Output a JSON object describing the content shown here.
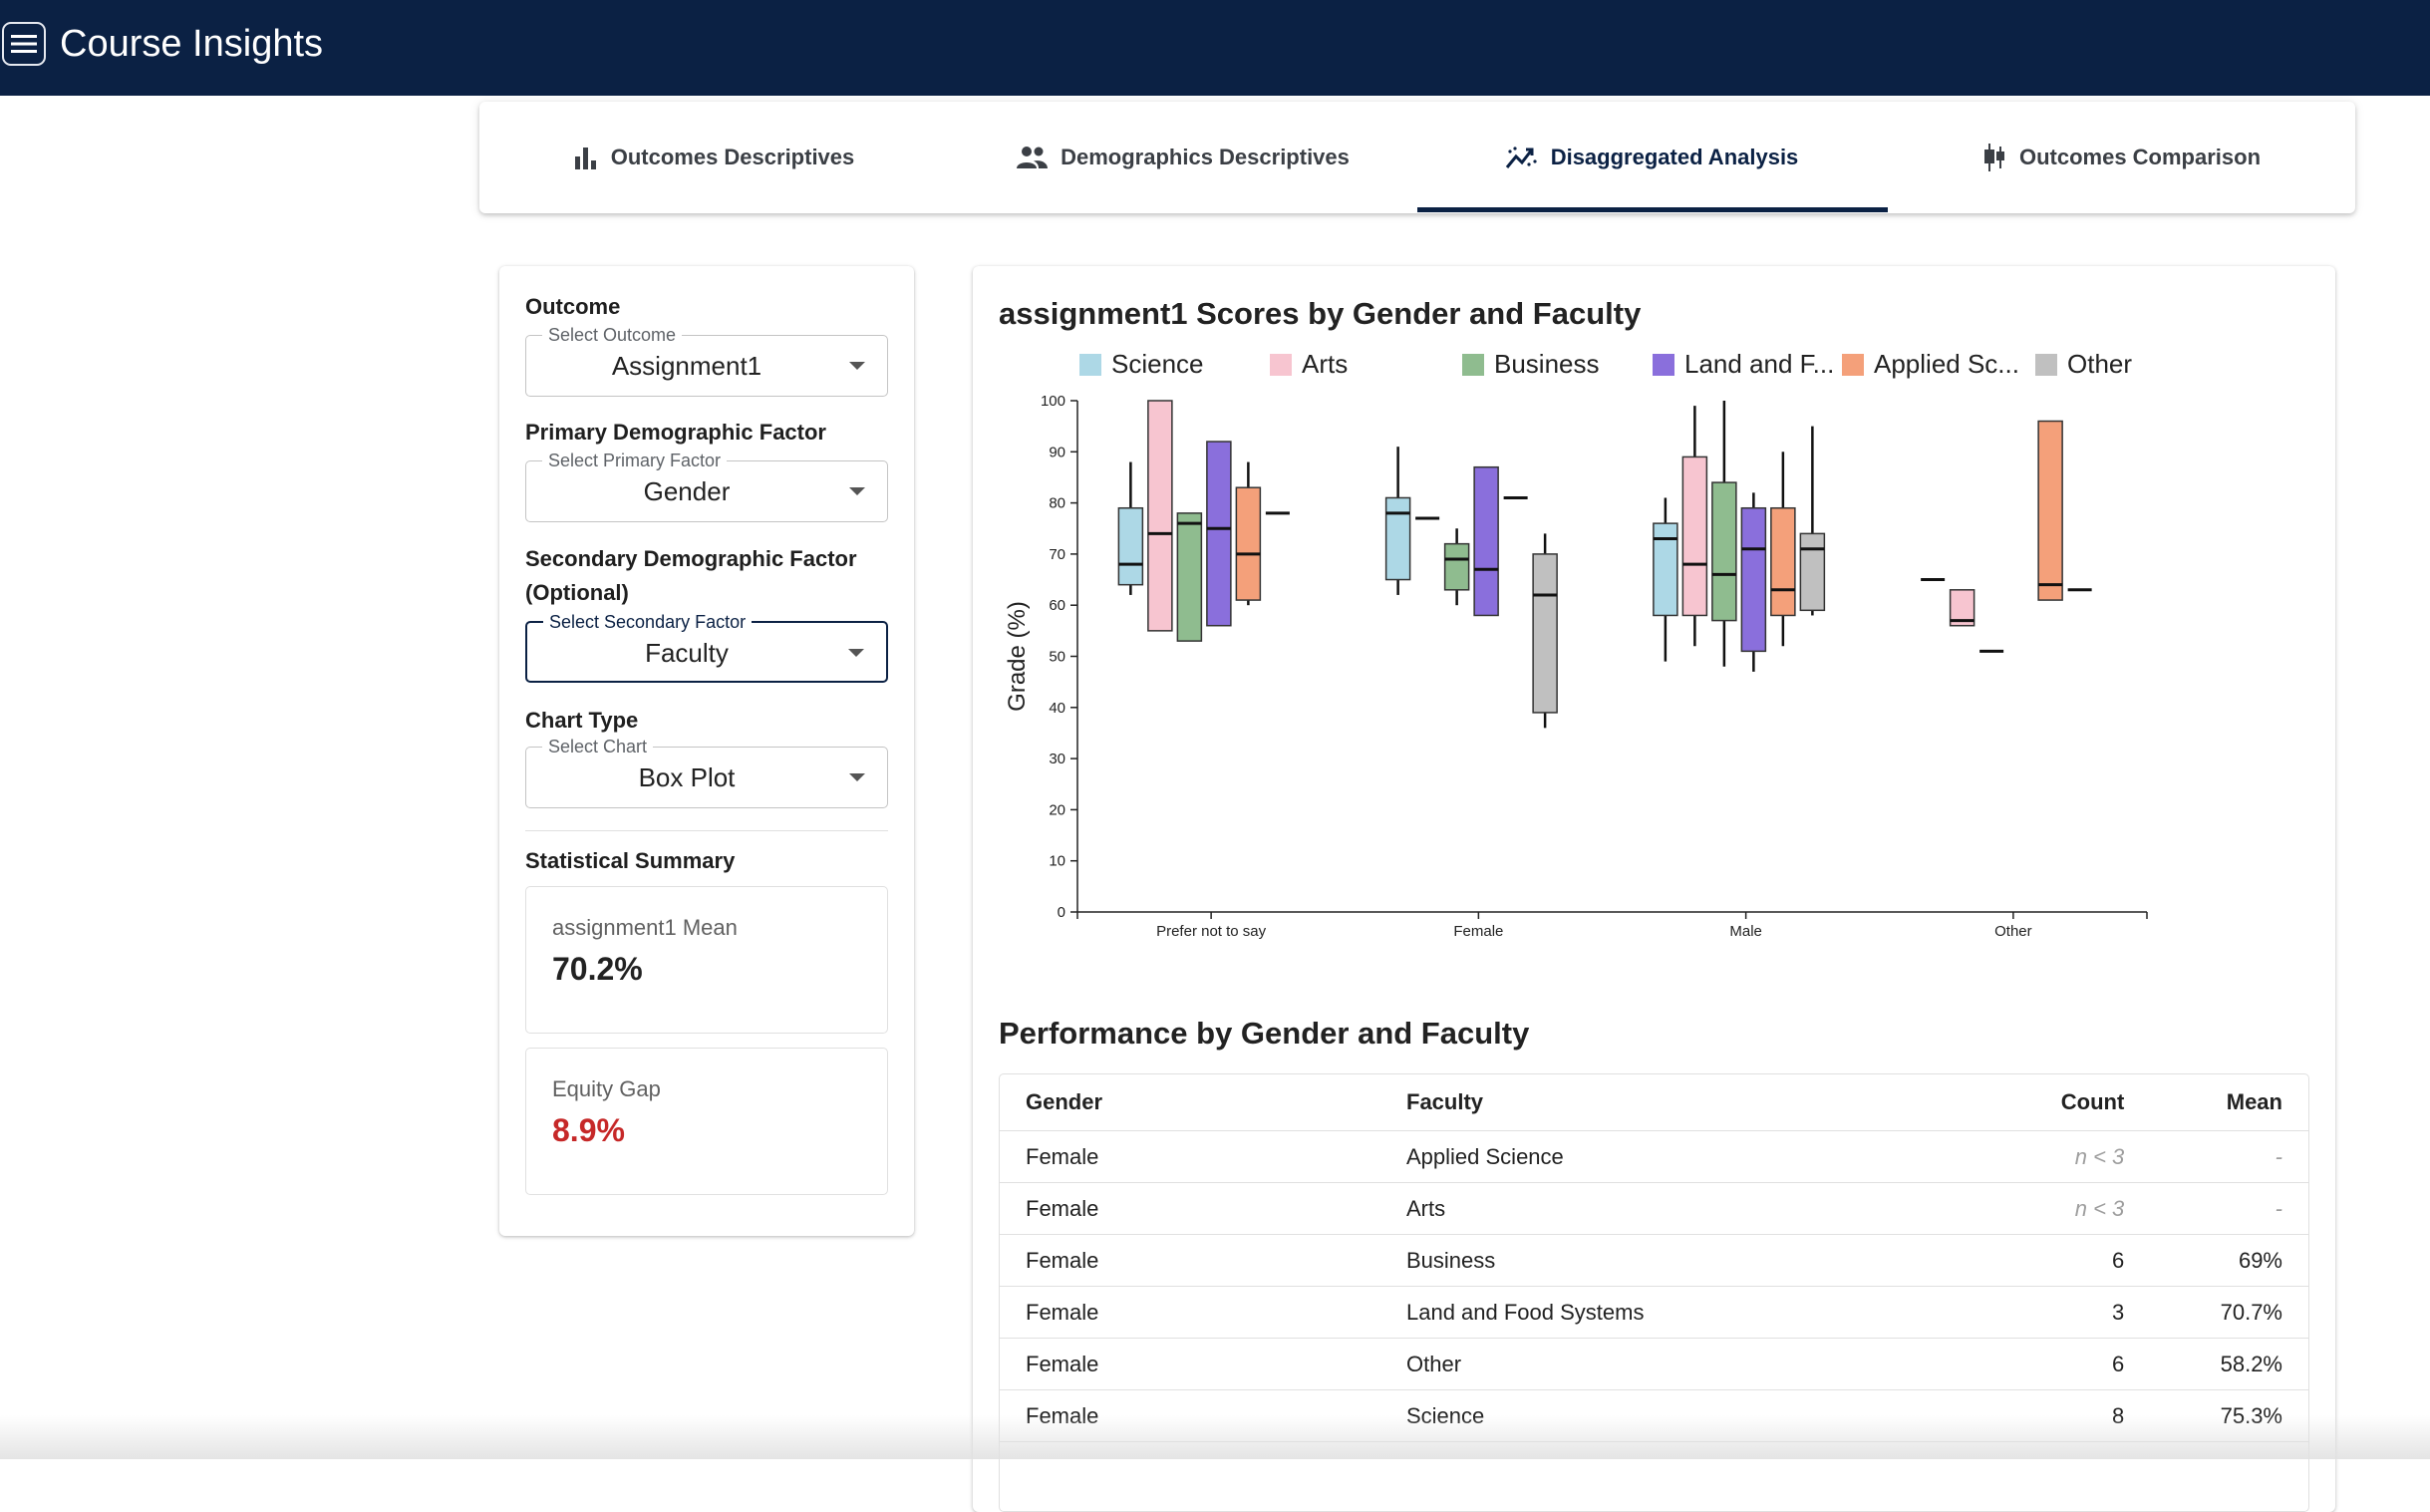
{
  "app": {
    "title": "Course Insights"
  },
  "tabs": [
    {
      "label": "Outcomes Descriptives",
      "icon": "bar-chart-icon"
    },
    {
      "label": "Demographics Descriptives",
      "icon": "people-icon"
    },
    {
      "label": "Disaggregated Analysis",
      "icon": "trend-icon",
      "active": true
    },
    {
      "label": "Outcomes Comparison",
      "icon": "candlestick-icon"
    }
  ],
  "controls": {
    "outcome": {
      "label": "Outcome",
      "legend": "Select Outcome",
      "value": "Assignment1"
    },
    "primary": {
      "label": "Primary Demographic Factor",
      "legend": "Select Primary Factor",
      "value": "Gender"
    },
    "secondary": {
      "label_line1": "Secondary Demographic Factor",
      "label_line2": "(Optional)",
      "legend": "Select Secondary Factor",
      "value": "Faculty"
    },
    "chart_type": {
      "label": "Chart Type",
      "legend": "Select Chart",
      "value": "Box Plot"
    }
  },
  "summary": {
    "title": "Statistical Summary",
    "mean_label": "assignment1 Mean",
    "mean_value": "70.2%",
    "gap_label": "Equity Gap",
    "gap_value": "8.9%",
    "gap_color": "#c62828"
  },
  "chart_data": {
    "type": "box",
    "title": "assignment1 Scores by Gender and Faculty",
    "ylabel": "Grade (%)",
    "xlabel": "",
    "ylim": [
      0,
      100
    ],
    "yticks": [
      0,
      10,
      20,
      30,
      40,
      50,
      60,
      70,
      80,
      90,
      100
    ],
    "categories": [
      "Prefer not to say",
      "Female",
      "Male",
      "Other"
    ],
    "legend": [
      {
        "name": "Science",
        "color": "#add8e6"
      },
      {
        "name": "Arts",
        "color": "#f7c5d0"
      },
      {
        "name": "Business",
        "color": "#8fbc8f"
      },
      {
        "name": "Land and F...",
        "color": "#8a6fdc"
      },
      {
        "name": "Applied Sc...",
        "color": "#f4a07a"
      },
      {
        "name": "Other",
        "color": "#c0c0c0"
      }
    ],
    "boxes": [
      {
        "category": "Prefer not to say",
        "series": "Science",
        "min": 62,
        "q1": 64,
        "median": 68,
        "q3": 79,
        "max": 88
      },
      {
        "category": "Prefer not to say",
        "series": "Arts",
        "min": 55,
        "q1": 55,
        "median": 74,
        "q3": 100,
        "max": 100
      },
      {
        "category": "Prefer not to say",
        "series": "Business",
        "min": 53,
        "q1": 53,
        "median": 76,
        "q3": 78,
        "max": 78
      },
      {
        "category": "Prefer not to say",
        "series": "Land and F...",
        "min": 56,
        "q1": 56,
        "median": 75,
        "q3": 92,
        "max": 92
      },
      {
        "category": "Prefer not to say",
        "series": "Applied Sc...",
        "min": 60,
        "q1": 61,
        "median": 70,
        "q3": 83,
        "max": 88
      },
      {
        "category": "Prefer not to say",
        "series": "Other",
        "min": 78,
        "q1": 78,
        "median": 78,
        "q3": 78,
        "max": 78
      },
      {
        "category": "Female",
        "series": "Science",
        "min": 62,
        "q1": 65,
        "median": 78,
        "q3": 81,
        "max": 91
      },
      {
        "category": "Female",
        "series": "Arts",
        "min": 77,
        "q1": 77,
        "median": 77,
        "q3": 77,
        "max": 77
      },
      {
        "category": "Female",
        "series": "Business",
        "min": 60,
        "q1": 63,
        "median": 69,
        "q3": 72,
        "max": 75
      },
      {
        "category": "Female",
        "series": "Land and F...",
        "min": 58,
        "q1": 58,
        "median": 67,
        "q3": 87,
        "max": 87
      },
      {
        "category": "Female",
        "series": "Applied Sc...",
        "min": 81,
        "q1": 81,
        "median": 81,
        "q3": 81,
        "max": 81
      },
      {
        "category": "Female",
        "series": "Other",
        "min": 36,
        "q1": 39,
        "median": 62,
        "q3": 70,
        "max": 74
      },
      {
        "category": "Male",
        "series": "Science",
        "min": 49,
        "q1": 58,
        "median": 73,
        "q3": 76,
        "max": 81
      },
      {
        "category": "Male",
        "series": "Arts",
        "min": 52,
        "q1": 58,
        "median": 68,
        "q3": 89,
        "max": 99
      },
      {
        "category": "Male",
        "series": "Business",
        "min": 48,
        "q1": 57,
        "median": 66,
        "q3": 84,
        "max": 100
      },
      {
        "category": "Male",
        "series": "Land and F...",
        "min": 47,
        "q1": 51,
        "median": 71,
        "q3": 79,
        "max": 82
      },
      {
        "category": "Male",
        "series": "Applied Sc...",
        "min": 52,
        "q1": 58,
        "median": 63,
        "q3": 79,
        "max": 90
      },
      {
        "category": "Male",
        "series": "Other",
        "min": 58,
        "q1": 59,
        "median": 71,
        "q3": 74,
        "max": 95
      },
      {
        "category": "Other",
        "series": "Science",
        "min": 65,
        "q1": 65,
        "median": 65,
        "q3": 65,
        "max": 65
      },
      {
        "category": "Other",
        "series": "Arts",
        "min": 56,
        "q1": 56,
        "median": 57,
        "q3": 63,
        "max": 63
      },
      {
        "category": "Other",
        "series": "Business",
        "min": 51,
        "q1": 51,
        "median": 51,
        "q3": 51,
        "max": 51
      },
      {
        "category": "Other",
        "series": "Applied Sc...",
        "min": 61,
        "q1": 61,
        "median": 64,
        "q3": 96,
        "max": 96
      },
      {
        "category": "Other",
        "series": "Other",
        "min": 63,
        "q1": 63,
        "median": 63,
        "q3": 63,
        "max": 63
      }
    ]
  },
  "table": {
    "title": "Performance by Gender and Faculty",
    "headers": {
      "gender": "Gender",
      "faculty": "Faculty",
      "count": "Count",
      "mean": "Mean"
    },
    "rows": [
      {
        "gender": "Female",
        "faculty": "Applied Science",
        "count": "n < 3",
        "mean": "-"
      },
      {
        "gender": "Female",
        "faculty": "Arts",
        "count": "n < 3",
        "mean": "-"
      },
      {
        "gender": "Female",
        "faculty": "Business",
        "count": "6",
        "mean": "69%"
      },
      {
        "gender": "Female",
        "faculty": "Land and Food Systems",
        "count": "3",
        "mean": "70.7%"
      },
      {
        "gender": "Female",
        "faculty": "Other",
        "count": "6",
        "mean": "58.2%"
      },
      {
        "gender": "Female",
        "faculty": "Science",
        "count": "8",
        "mean": "75.3%"
      }
    ]
  }
}
